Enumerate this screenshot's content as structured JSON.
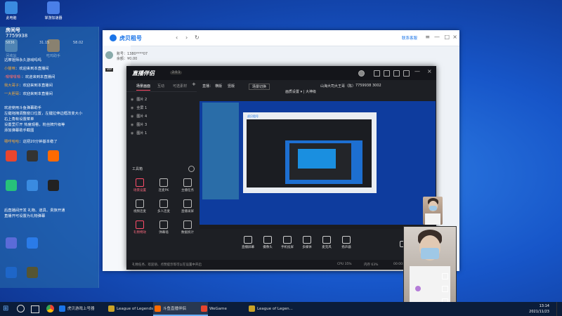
{
  "colors": {
    "accent": "#1a74e8",
    "live_red": "#ff4d6a",
    "desktop": "#1756c9"
  },
  "desktop_icons": [
    {
      "label": "此电脑",
      "color": "#3a8be0"
    },
    {
      "label": "掌游加速器",
      "color": "#4a7fe8"
    },
    {
      "label": "回收站",
      "color": "#7fa0c0"
    },
    {
      "label": "吃鸡助手",
      "color": "#ff9a2a"
    }
  ],
  "chat": {
    "room_label": "房间号",
    "room_id": "7759938",
    "stats": [
      "5836",
      "31.15",
      "58.02"
    ],
    "lines": [
      {
        "nick": "",
        "text": "达摩祖师永久游戏吗吗"
      },
      {
        "nick": "小猫咪",
        "cls": "gold",
        "text": "：欢迎来到本直播间"
      },
      {
        "nick": "·嘿嘿嘿嘿·",
        "cls": "red",
        "text": "：欢迎来到本直播间"
      },
      {
        "nick": "我大哥子",
        "cls": "gold",
        "text": "：欢迎来到本直播间"
      },
      {
        "nick": "一大胆哥",
        "cls": "gold",
        "text": "：欢迎来到本直播间"
      },
      {
        "nick": "",
        "text": "欢迎使用斗鱼弹幕助手"
      },
      {
        "nick": "",
        "text": "左键拖拽调整窗口位置，左键拉伸边框改变大小"
      },
      {
        "nick": "",
        "text": "右上角有设置菜单"
      },
      {
        "nick": "",
        "text": "设置里打开 热度观看，粉丝牌升级等"
      },
      {
        "nick": "",
        "text": "添加弹幕助手截图"
      },
      {
        "nick": "嗯哼哈哈",
        "cls": "gold",
        "text": "：这把20分钟基本稳了"
      },
      {
        "nick": "",
        "text": "后直播间开发 礼物、道具、贵族开通"
      },
      {
        "nick": "",
        "text": "直播开可设置为礼物弹幕"
      }
    ]
  },
  "huwin": {
    "logo": "虎贝租号",
    "service": "联系客服",
    "user_lines": [
      "账号：1380****07",
      "余额：¥0.00"
    ],
    "badge": "VIP"
  },
  "zb": {
    "brand": "直播伴侣",
    "version": "2.0.1",
    "tabs": [
      "场景画面",
      "互动",
      "可选素材"
    ],
    "info": [
      "直播：",
      "横版",
      "竖版",
      "场景切换",
      "山海大司大王哥（陈）",
      "7759938",
      "3002",
      "画质设置 ▾  | 大神级"
    ],
    "scenes": [
      "图片 2",
      "全屏 1",
      "图片 4",
      "图片 3",
      "图片 1"
    ],
    "tools_title": "工具箱",
    "tools": [
      {
        "label": "场景设置",
        "hot": true
      },
      {
        "label": "连麦PK",
        "hot": false
      },
      {
        "label": "主播任务",
        "hot": false
      },
      {
        "label": "视频连麦",
        "hot": false
      },
      {
        "label": "多人连麦",
        "hot": false
      },
      {
        "label": "直播录屏",
        "hot": false
      },
      {
        "label": "礼物特效",
        "hot": true
      },
      {
        "label": "弹幕墙",
        "hot": false
      },
      {
        "label": "数据统计",
        "hot": false
      }
    ],
    "bottom": [
      {
        "label": "直播屏幕"
      },
      {
        "label": "摄像头"
      },
      {
        "label": "手机投屏"
      },
      {
        "label": "多媒体"
      },
      {
        "label": "麦克风"
      },
      {
        "label": "扬声器"
      }
    ],
    "status": [
      "礼物任务、欢迎语、点赞提示等可以在设置中开启",
      "CPU 35%",
      "内存 63%",
      "00:00:00"
    ]
  },
  "taskbar": {
    "items": [
      {
        "label": "虎贝游戏上号器",
        "color": "#1a74e8"
      },
      {
        "label": "League of Legends",
        "color": "#c9a227"
      },
      {
        "label": "斗鱼直播伴侣",
        "color": "#ff6a00"
      },
      {
        "label": "WeGame",
        "color": "#e8452e"
      },
      {
        "label": "League of Legen...",
        "color": "#c9a227"
      }
    ],
    "time": "13:14",
    "date": "2021/11/23"
  }
}
